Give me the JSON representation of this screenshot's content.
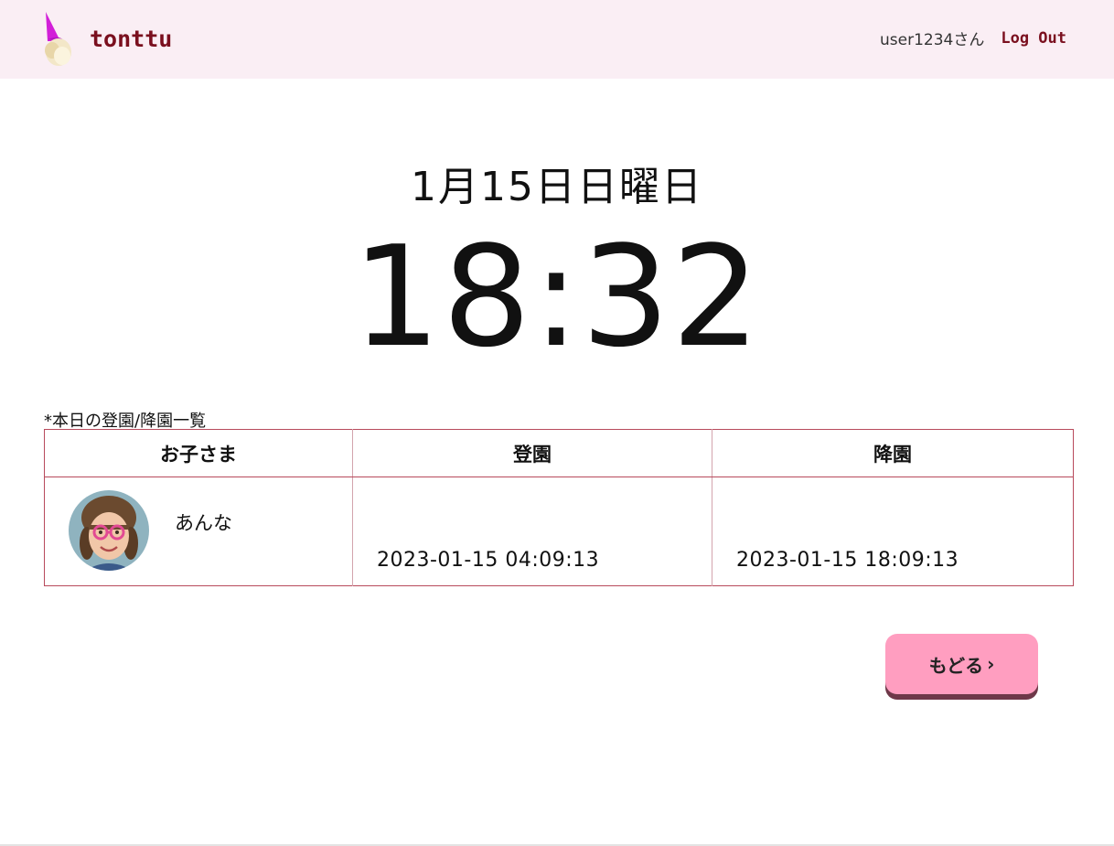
{
  "header": {
    "logo_text": "tonttu",
    "username": "user1234さん",
    "logout_label": "Log Out"
  },
  "main": {
    "date": "1月15日日曜日",
    "time": "18:32",
    "list_caption": "*本日の登園/降園一覧"
  },
  "table": {
    "columns": [
      "お子さま",
      "登園",
      "降園"
    ],
    "rows": [
      {
        "child_name": "あんな",
        "checkin": "2023-01-15 04:09:13",
        "checkout": "2023-01-15 18:09:13"
      }
    ]
  },
  "back_button": {
    "label": "もどる",
    "chevron": "›"
  },
  "colors": {
    "header_bg": "#faeef4",
    "brand": "#7a0f1e",
    "button": "#ff9ec0",
    "table_border": "#b84a5c"
  },
  "icons": {
    "logo": "gnome-logo-icon",
    "back": "chevron-right-icon"
  }
}
